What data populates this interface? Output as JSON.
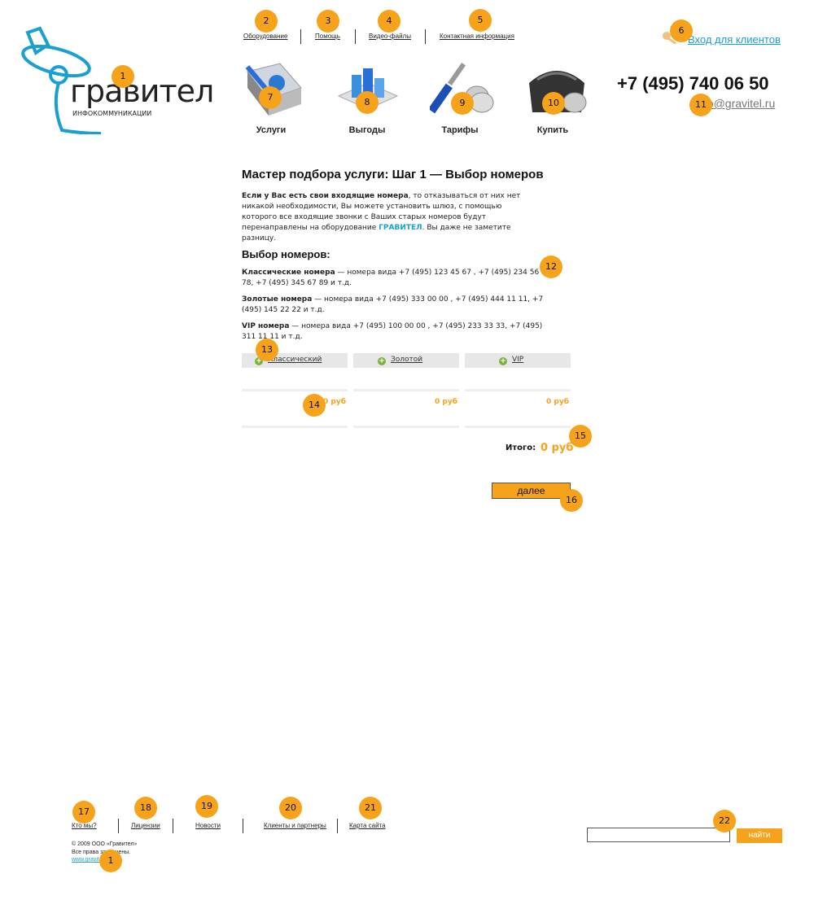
{
  "header": {
    "logo": {
      "name": "гравител",
      "tagline": "ИНФОКОММУНИКАЦИИ"
    },
    "top_links": [
      "Оборудование",
      "Помощь",
      "Видео-файлы",
      "Контактная информация"
    ],
    "client_login": "Вход для клиентов",
    "phone": "+7 (495) 740 06 50",
    "email": "info@gravitel.ru",
    "nav": [
      {
        "label": "Услуги",
        "icon": "book-icon"
      },
      {
        "label": "Выгоды",
        "icon": "chart-icon"
      },
      {
        "label": "Тарифы",
        "icon": "tools-icon"
      },
      {
        "label": "Купить",
        "icon": "wallet-icon"
      }
    ]
  },
  "main": {
    "title": "Мастер подбора услуги: Шаг 1 — Выбор номеров",
    "intro_bold": "Если у Вас есть свои входящие номера",
    "intro_rest": ", то отказываться от них нет никакой необходимости, Вы можете установить шлюз, с помощью которого все входящие звонки с Ваших старых номеров будут перенаправлены на оборудование ",
    "intro_brand": "ГРАВИТЕЛ",
    "intro_end": ". Вы даже не заметите разницу.",
    "section_title": "Выбор номеров:",
    "number_types": [
      {
        "name": "Классические номера",
        "desc": " — номера вида  +7 (495) 123 45 67 ,  +7 (495) 234 56 78, +7 (495) 345 67 89 и т.д."
      },
      {
        "name": "Золотые номера",
        "desc": " — номера вида  +7 (495) 333 00 00 ,  +7 (495) 444 11 11, +7 (495) 145 22 22 и т.д."
      },
      {
        "name": "VIP номера",
        "desc": " — номера вида  +7 (495) 100 00 00 ,  +7 (495) 233 33 33, +7 (495) 311 11 11 и т.д."
      }
    ],
    "tabs": [
      "Классический",
      "Золотой",
      "VIP"
    ],
    "prices": [
      "0 руб",
      "0 руб",
      "0 руб"
    ],
    "total_label": "Итого:",
    "total_value": "0 руб",
    "next_button": "далее"
  },
  "footer": {
    "links": [
      "Кто мы?",
      "Лицензии",
      "Новости",
      "Клиенты и партнеры",
      "Карта сайта"
    ],
    "copyright": "© 2009 ООО «Гравител»",
    "rights": "Все права защищены.",
    "site_link": "www.gravitel.ru",
    "search_placeholder": "",
    "search_button": "найти"
  },
  "badges": [
    "1",
    "2",
    "3",
    "4",
    "5",
    "6",
    "7",
    "8",
    "9",
    "10",
    "11",
    "12",
    "13",
    "14",
    "15",
    "16",
    "17",
    "18",
    "19",
    "20",
    "21",
    "22",
    "1"
  ],
  "colors": {
    "accent": "#f7a21b",
    "link": "#1a9fd1",
    "brand": "#1a9fd1",
    "plus": "#7bb33a"
  }
}
